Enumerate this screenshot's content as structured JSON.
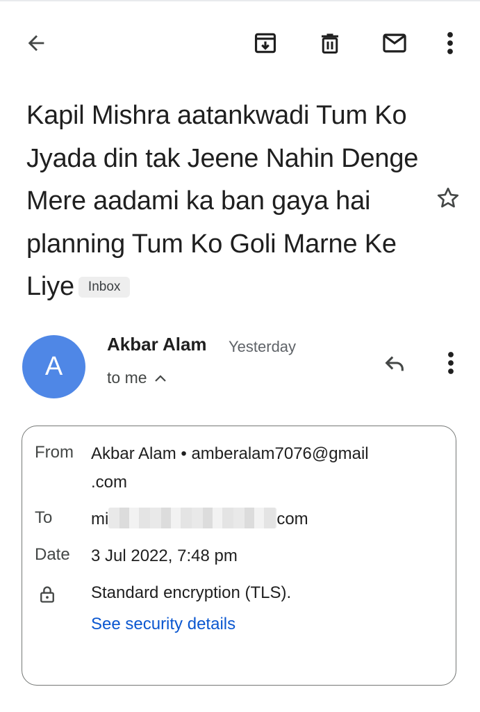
{
  "toolbar": {
    "icons": [
      "arrow-back-icon",
      "archive-icon",
      "trash-icon",
      "mail-icon",
      "more-vert-icon"
    ]
  },
  "email": {
    "subject": "Kapil Mishra aatankwadi Tum Ko Jyada din tak Jeene Nahin Denge Mere aadami ka ban gaya hai planning Tum Ko Goli Marne Ke Liye",
    "label": "Inbox",
    "sender_initial": "A",
    "sender_name": "Akbar Alam",
    "time": "Yesterday",
    "recipient_summary": "to me"
  },
  "details": {
    "from_label": "From",
    "from_value": "Akbar Alam • amberalam7076@gmail",
    "from_value_cont": ".com",
    "to_label": "To",
    "to_prefix": "mi",
    "to_suffix": "com",
    "date_label": "Date",
    "date_value": "3 Jul 2022, 7:48 pm",
    "security_text": "Standard encryption (TLS).",
    "security_link": "See security details"
  },
  "colors": {
    "avatar": "#4f87e6",
    "link": "#0b57d0",
    "chip_bg": "#eeeeee"
  }
}
